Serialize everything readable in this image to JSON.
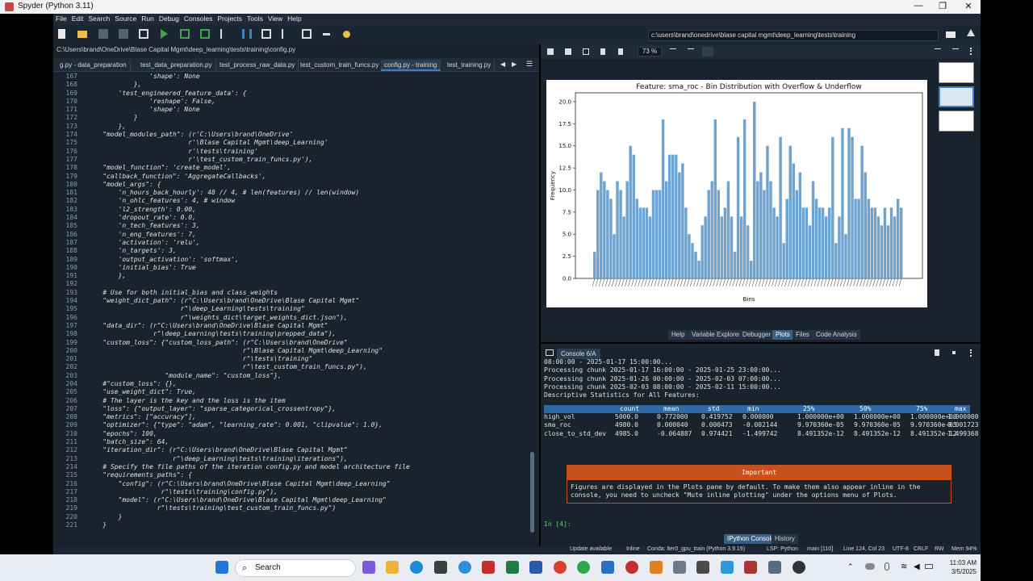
{
  "window": {
    "title": "Spyder (Python 3.11)",
    "controls": [
      "—",
      "❐",
      "✕"
    ]
  },
  "menu": [
    "File",
    "Edit",
    "Search",
    "Source",
    "Run",
    "Debug",
    "Consoles",
    "Projects",
    "Tools",
    "View",
    "Help"
  ],
  "toolbar": {
    "path": "c:\\users\\brand\\onedrive\\blase capital mgmt\\deep_learning\\tests\\training"
  },
  "editor": {
    "filepath": "C:\\Users\\brand\\OneDrive\\Blase Capital Mgmt\\deep_learning\\tests\\training\\config.py",
    "tabs": [
      "g.py - data_preparation",
      "test_data_preparation.py",
      "test_process_raw_data.py",
      "test_custom_train_funcs.py",
      "config.py - training",
      "test_training.py"
    ],
    "active_tab": 4,
    "lines": [
      {
        "n": "167",
        "t": "                'shape': None"
      },
      {
        "n": "168",
        "t": "            },"
      },
      {
        "n": "169",
        "t": "        'test_engineered_feature_data': {"
      },
      {
        "n": "170",
        "t": "                'reshape': False,"
      },
      {
        "n": "171",
        "t": "                'shape': None"
      },
      {
        "n": "172",
        "t": "            }"
      },
      {
        "n": "173",
        "t": "        },"
      },
      {
        "n": "174",
        "t": "    \"model_modules_path\": (r'C:\\Users\\brand\\OneDrive'"
      },
      {
        "n": "175",
        "t": "                          r'\\Blase Capital Mgmt\\deep_Learning'"
      },
      {
        "n": "176",
        "t": "                          r'\\tests\\training'"
      },
      {
        "n": "177",
        "t": "                          r'\\test_custom_train_funcs.py'),"
      },
      {
        "n": "178",
        "t": "    \"model_function\": 'create_model',"
      },
      {
        "n": "179",
        "t": "    \"callback_function\": 'AggregateCallbacks',"
      },
      {
        "n": "180",
        "t": "    \"model_args\": {"
      },
      {
        "n": "181",
        "t": "        'n_hours_back_hourly': 48 // 4, # len(features) // len(window)"
      },
      {
        "n": "182",
        "t": "        'n_ohlc_features': 4, # window"
      },
      {
        "n": "183",
        "t": "        'l2_strength': 0.00,"
      },
      {
        "n": "184",
        "t": "        'dropout_rate': 0.0,"
      },
      {
        "n": "185",
        "t": "        'n_tech_features': 3,"
      },
      {
        "n": "186",
        "t": "        'n_eng_features': 7,"
      },
      {
        "n": "187",
        "t": "        'activation': 'relu',"
      },
      {
        "n": "188",
        "t": "        'n_targets': 3,"
      },
      {
        "n": "189",
        "t": "        'output_activation': 'softmax',"
      },
      {
        "n": "190",
        "t": "        'initial_bias': True"
      },
      {
        "n": "191",
        "t": "        },"
      },
      {
        "n": "192",
        "t": ""
      },
      {
        "n": "193",
        "t": "    # Use for both initial_bias and class_weights"
      },
      {
        "n": "194",
        "t": "    \"weight_dict_path\": (r\"C:\\Users\\brand\\OneDrive\\Blase Capital Mgmt\""
      },
      {
        "n": "195",
        "t": "                        r\"\\deep_Learning\\tests\\training\""
      },
      {
        "n": "196",
        "t": "                        r\"\\weights_dict\\target_weights_dict.json\"),"
      },
      {
        "n": "197",
        "t": "    \"data_dir\": (r\"C:\\Users\\brand\\OneDrive\\Blase Capital Mgmt\""
      },
      {
        "n": "198",
        "t": "                 r\"\\deep_Learning\\tests\\training\\prepped_data\"),"
      },
      {
        "n": "199",
        "t": "    \"custom_loss\": {\"custom_loss_path\": (r\"C:\\Users\\brand\\OneDrive\""
      },
      {
        "n": "200",
        "t": "                                        r\"\\Blase Capital Mgmt\\deep_Learning\""
      },
      {
        "n": "201",
        "t": "                                        r\"\\tests\\training\""
      },
      {
        "n": "202",
        "t": "                                        r\"\\test_custom_train_funcs.py\"),"
      },
      {
        "n": "203",
        "t": "                    \"module_name\": \"custom_loss\"},"
      },
      {
        "n": "204",
        "t": "    #\"custom_loss\": {},"
      },
      {
        "n": "205",
        "t": "    \"use_weight_dict\": True,"
      },
      {
        "n": "206",
        "t": "    # The layer is the key and the loss is the item"
      },
      {
        "n": "207",
        "t": "    \"loss\": {\"output_layer\": \"sparse_categorical_crossentropy\"},"
      },
      {
        "n": "208",
        "t": "    \"metrics\": [\"accuracy\"],"
      },
      {
        "n": "209",
        "t": "    \"optimizer\": {\"type\": \"adam\", \"learning_rate\": 0.001, \"clipvalue\": 1.0},"
      },
      {
        "n": "210",
        "t": "    \"epochs\": 100,"
      },
      {
        "n": "211",
        "t": "    \"batch_size\": 64,"
      },
      {
        "n": "212",
        "t": "    \"iteration_dir\": (r\"C:\\Users\\brand\\OneDrive\\Blase Capital Mgmt\""
      },
      {
        "n": "213",
        "t": "                      r\"\\deep_Learning\\tests\\training\\iterations\"),"
      },
      {
        "n": "214",
        "t": "    # Specify the file paths of the iteration config.py and model architecture file"
      },
      {
        "n": "215",
        "t": "    \"requirements_paths\": {"
      },
      {
        "n": "216",
        "t": "        \"config\": (r\"C:\\Users\\brand\\OneDrive\\Blase Capital Mgmt\\deep_Learning\""
      },
      {
        "n": "217",
        "t": "                   r\"\\tests\\training\\config.py\"),"
      },
      {
        "n": "218",
        "t": "        \"model\": (r\"C:\\Users\\brand\\OneDrive\\Blase Capital Mgmt\\deep_Learning\""
      },
      {
        "n": "219",
        "t": "                  r\"\\tests\\training\\test_custom_train_funcs.py\")"
      },
      {
        "n": "220",
        "t": "        }"
      },
      {
        "n": "221",
        "t": "    }"
      }
    ]
  },
  "plots": {
    "zoom": "73 %",
    "pane_tabs": [
      "Help",
      "Variable Explorer",
      "Debugger",
      "Plots",
      "Files",
      "Code Analysis"
    ],
    "active_pane_tab": 3
  },
  "chart_data": {
    "type": "bar",
    "title": "Feature: sma_roc - Bin Distribution with Overflow & Underflow",
    "xlabel": "Bins",
    "ylabel": "Frequency",
    "ylim": [
      0,
      21
    ],
    "yticks": [
      "0.0",
      "2.5",
      "5.0",
      "7.5",
      "10.0",
      "12.5",
      "15.0",
      "17.5",
      "20.0"
    ],
    "values": [
      3,
      10,
      12,
      11,
      10,
      9,
      5,
      11,
      10,
      7,
      11,
      15,
      14,
      9,
      8,
      8,
      8,
      7,
      10,
      10,
      10,
      18,
      11,
      14,
      14,
      14,
      12,
      13,
      8,
      5,
      4,
      3,
      2,
      6,
      7,
      10,
      11,
      18,
      10,
      7,
      8,
      11,
      7,
      3,
      16,
      7,
      18,
      6,
      2,
      20,
      11,
      12,
      10,
      15,
      11,
      8,
      7,
      16,
      4,
      9,
      15,
      13,
      10,
      12,
      8,
      8,
      6,
      11,
      9,
      8,
      8,
      7,
      8,
      16,
      4,
      7,
      17,
      5,
      17,
      16,
      9,
      9,
      15,
      12,
      9,
      8,
      8,
      7,
      6,
      8,
      6,
      8,
      7,
      9,
      8
    ]
  },
  "console": {
    "tab": "Console 6/A",
    "lines": [
      "08:00:00 - 2025-01-17 15:00:00...",
      "Processing chunk 2025-01-17 16:00:00 - 2025-01-25 23:00:00...",
      "Processing chunk 2025-01-26 00:00:00 - 2025-02-03 07:00:00...",
      "Processing chunk 2025-02-03 08:00:00 - 2025-02-11 15:00:00...",
      "Descriptive Statistics for All Features:"
    ],
    "stats_header": [
      "count",
      "mean",
      "std",
      "min",
      "25%",
      "50%",
      "75%",
      "max"
    ],
    "stats_rows": [
      [
        "high_vol",
        "5000.0",
        "0.772000",
        "0.419752",
        "0.000000",
        "1.000000e+00",
        "1.000000e+00",
        "1.000000e+00",
        "1.000000"
      ],
      [
        "sma_roc",
        "4980.0",
        "0.000040",
        "0.000473",
        "-0.002144",
        "9.970360e-05",
        "9.970360e-05",
        "9.970360e-05",
        "0.001723"
      ],
      [
        "close_to_std_dev",
        "4985.0",
        "-0.064887",
        "0.974421",
        "-1.499742",
        "8.491352e-12",
        "8.491352e-12",
        "8.491352e-12",
        "1.499368"
      ]
    ],
    "important_title": "Important",
    "important_body1": "Figures are displayed in the Plots pane by default. To make them also appear inline in the",
    "important_body2": "console, you need to uncheck \"Mute inline plotting\" under the options menu of Plots.",
    "prompt": "In [4]:",
    "bottom_tabs": [
      "IPython Console",
      "History"
    ]
  },
  "status": {
    "update": "Update available",
    "inline": "Inline",
    "conda": "Conda: lter0_gpu_train (Python 3.9.19)",
    "lsp": "LSP: Python",
    "git": "main [110]",
    "position": "Line 124, Col 23",
    "encoding": "UTF-8",
    "eol": "CRLF",
    "rw": "RW",
    "mem": "Mem 94%"
  },
  "taskbar": {
    "search": "Search",
    "time": "11:03 AM",
    "date": "3/5/2025"
  }
}
